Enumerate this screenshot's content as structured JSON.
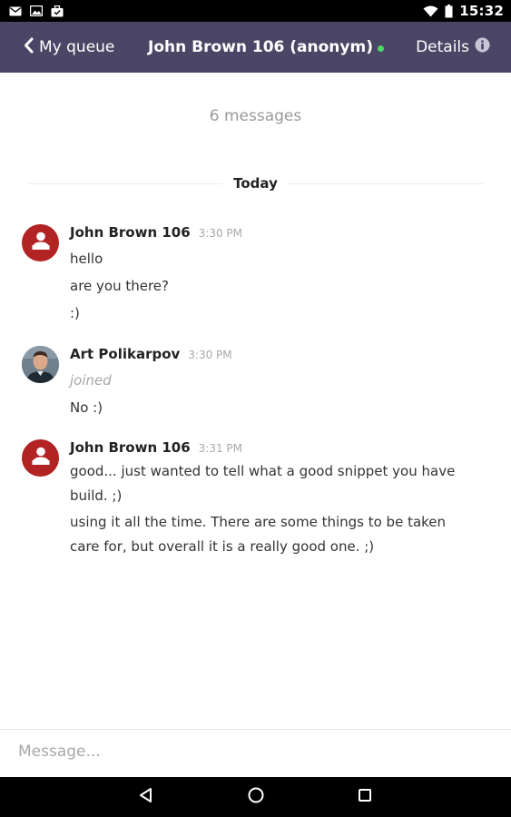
{
  "status_bar": {
    "time": "15:32",
    "icons": [
      "mail-icon",
      "image-icon",
      "briefcase-icon",
      "wifi-icon",
      "battery-icon"
    ]
  },
  "header": {
    "back_label": "My queue",
    "title": "John Brown 106 (anonym)",
    "online_color": "#4cd964",
    "details_label": "Details",
    "background_color": "#4c4666"
  },
  "conversation": {
    "message_count": "6 messages",
    "day_label": "Today",
    "groups": [
      {
        "author": "John Brown 106",
        "time": "3:30 PM",
        "avatar": "default-user-avatar",
        "avatar_color": "#b22424",
        "lines": [
          "hello",
          "are you there?",
          ":)"
        ]
      },
      {
        "author": "Art Polikarpov",
        "time": "3:30 PM",
        "avatar": "photo-avatar",
        "status": "joined",
        "lines": [
          "No :)"
        ]
      },
      {
        "author": "John Brown 106",
        "time": "3:31 PM",
        "avatar": "default-user-avatar",
        "avatar_color": "#b22424",
        "lines": [
          "good... just wanted to tell what a good snippet you have build.  ;)",
          "using it all the time. There are some things to be taken care for, but overall it is a really good one. ;)"
        ]
      }
    ]
  },
  "composer": {
    "placeholder": "Message...",
    "value": ""
  },
  "nav_bar": {
    "buttons": [
      "back-triangle-icon",
      "home-circle-icon",
      "recents-square-icon"
    ]
  }
}
